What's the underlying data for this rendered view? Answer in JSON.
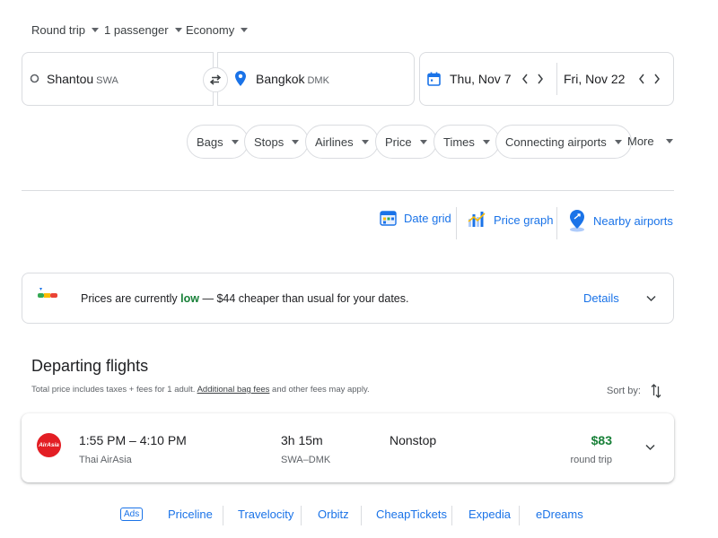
{
  "top": {
    "trip_type": "Round trip",
    "passengers": "1 passenger",
    "cabin": "Economy"
  },
  "search": {
    "origin_city": "Shantou",
    "origin_code": "SWA",
    "destination_city": "Bangkok",
    "destination_code": "DMK",
    "depart_date": "Thu, Nov 7",
    "return_date": "Fri, Nov 22"
  },
  "filters": {
    "chips": [
      "Bags",
      "Stops",
      "Airlines",
      "Price",
      "Times",
      "Connecting airports"
    ],
    "more": "More"
  },
  "tools": {
    "date_grid": "Date grid",
    "price_graph": "Price graph",
    "nearby_airports": "Nearby airports"
  },
  "insight": {
    "prefix": "Prices are currently ",
    "level": "low",
    "suffix": " — $44 cheaper than usual for your dates.",
    "details": "Details",
    "colors": {
      "low": "#188038",
      "accent": "#1a73e8"
    }
  },
  "results": {
    "title": "Departing flights",
    "sub_prefix": "Total price includes taxes + fees for 1 adult. ",
    "sub_link": "Additional bag fees",
    "sub_suffix": " and other fees may apply.",
    "sort_label": "Sort by:",
    "flights": [
      {
        "times": "1:55 PM – 4:10 PM",
        "airline": "Thai AirAsia",
        "logo_text": "AirAsia",
        "duration": "3h 15m",
        "route": "SWA–DMK",
        "stops": "Nonstop",
        "price": "$83",
        "price_note": "round trip"
      }
    ]
  },
  "ads": {
    "badge": "Ads",
    "links": [
      "Priceline",
      "Travelocity",
      "Orbitz",
      "CheapTickets",
      "Expedia",
      "eDreams"
    ]
  }
}
